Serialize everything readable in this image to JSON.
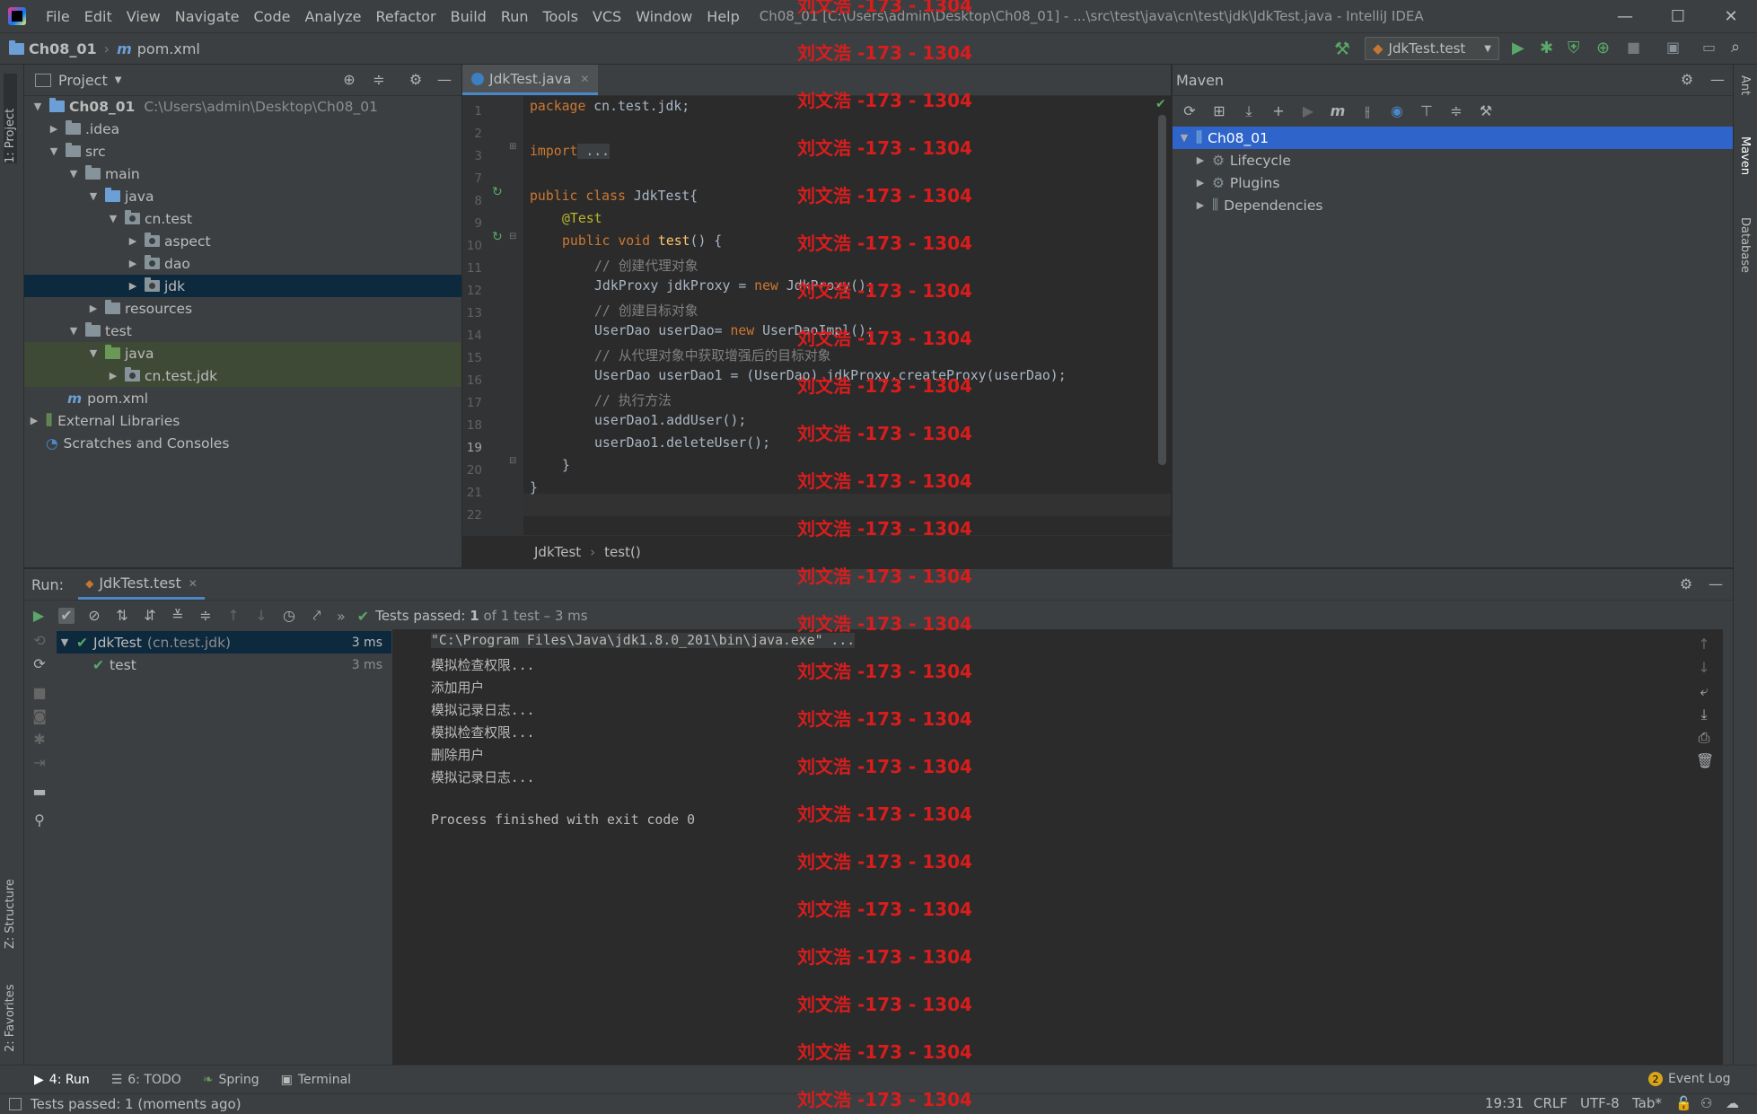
{
  "window": {
    "title": "Ch08_01 [C:\\Users\\admin\\Desktop\\Ch08_01] - ...\\src\\test\\java\\cn\\test\\jdk\\JdkTest.java - IntelliJ IDEA",
    "menu": [
      "File",
      "Edit",
      "View",
      "Navigate",
      "Code",
      "Analyze",
      "Refactor",
      "Build",
      "Run",
      "Tools",
      "VCS",
      "Window",
      "Help"
    ]
  },
  "navbar": {
    "project": "Ch08_01",
    "file": "pom.xml",
    "run_config": "JdkTest.test"
  },
  "left_strip": {
    "project_tab": "1: Project",
    "structure_tab": "Z: Structure",
    "favorites_tab": "2: Favorites"
  },
  "right_strip": {
    "ant": "Ant",
    "maven": "Maven",
    "database": "Database"
  },
  "project_panel": {
    "title": "Project",
    "tree": [
      {
        "label": "Ch08_01",
        "extra": "C:\\Users\\admin\\Desktop\\Ch08_01"
      },
      {
        "label": ".idea"
      },
      {
        "label": "src"
      },
      {
        "label": "main"
      },
      {
        "label": "java"
      },
      {
        "label": "cn.test"
      },
      {
        "label": "aspect"
      },
      {
        "label": "dao"
      },
      {
        "label": "jdk"
      },
      {
        "label": "resources"
      },
      {
        "label": "test"
      },
      {
        "label": "java"
      },
      {
        "label": "cn.test.jdk"
      },
      {
        "label": "pom.xml"
      },
      {
        "label": "External Libraries"
      },
      {
        "label": "Scratches and Consoles"
      }
    ]
  },
  "editor": {
    "tab": "JdkTest.java",
    "line_numbers": [
      "1",
      "2",
      "3",
      "7",
      "8",
      "9",
      "10",
      "11",
      "12",
      "13",
      "14",
      "15",
      "16",
      "17",
      "18",
      "19",
      "20",
      "21",
      "22"
    ],
    "code": {
      "l1_kw": "package",
      "l1": " cn.test.jdk;",
      "l3_kw": "import",
      "l3": " ...",
      "l8_kw": "public class",
      "l8": " JdkTest{",
      "l9": "@Test",
      "l10_kw": "public void",
      "l10_fn": " test",
      "l10": "() {",
      "l11": "// 创建代理对象",
      "l12a": "JdkProxy jdkProxy = ",
      "l12_kw": "new",
      "l12b": " JdkProxy();",
      "l13": "// 创建目标对象",
      "l14a": "UserDao userDao= ",
      "l14_kw": "new",
      "l14b": " UserDaoImpl();",
      "l15": "// 从代理对象中获取增强后的目标对象",
      "l16": "UserDao userDao1 = (UserDao) jdkProxy.createProxy(userDao);",
      "l17": "// 执行方法",
      "l18": "userDao1.addUser();",
      "l19": "userDao1.deleteUser();",
      "l20": "}",
      "l21": "}"
    },
    "breadcrumb": [
      "JdkTest",
      "test()"
    ]
  },
  "maven": {
    "title": "Maven",
    "tree": [
      "Ch08_01",
      "Lifecycle",
      "Plugins",
      "Dependencies"
    ]
  },
  "run": {
    "label": "Run:",
    "tab": "JdkTest.test",
    "status_prefix": "Tests passed:",
    "status_count": "1",
    "status_suffix": "of 1 test – 3 ms",
    "tree": [
      {
        "name": "JdkTest",
        "extra": "(cn.test.jdk)",
        "time": "3 ms"
      },
      {
        "name": "test",
        "time": "3 ms"
      }
    ],
    "console": [
      "\"C:\\Program Files\\Java\\jdk1.8.0_201\\bin\\java.exe\" ...",
      "模拟检查权限...",
      "添加用户",
      "模拟记录日志...",
      "模拟检查权限...",
      "删除用户",
      "模拟记录日志...",
      "",
      "Process finished with exit code 0"
    ]
  },
  "tool_windows": [
    "4: Run",
    "6: TODO",
    "Spring",
    "Terminal"
  ],
  "event_log": {
    "count": "2",
    "label": "Event Log"
  },
  "status": {
    "message": "Tests passed: 1 (moments ago)",
    "position": "19:31",
    "line_sep": "CRLF",
    "encoding": "UTF-8",
    "indent": "Tab*"
  },
  "watermark": "刘文浩 -173 - 1304"
}
